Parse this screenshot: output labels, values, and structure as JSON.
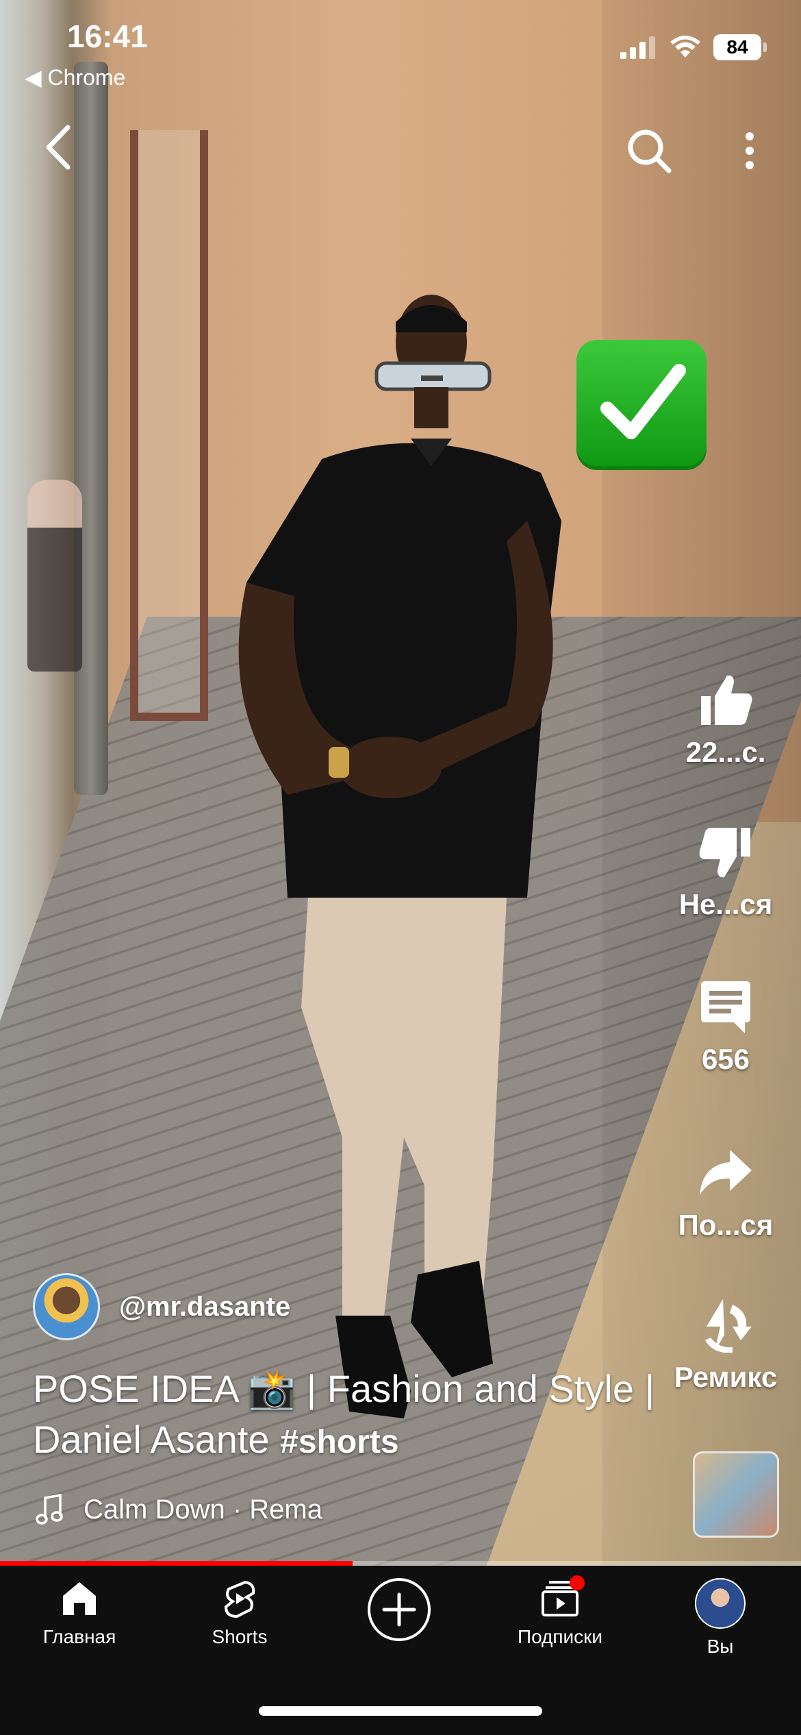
{
  "status_bar": {
    "time": "16:41",
    "back_app": "◀ Chrome",
    "battery": "84"
  },
  "top_bar": {
    "back_icon": "chevron-left-icon",
    "search_icon": "search-icon",
    "more_icon": "more-vertical-icon"
  },
  "overlay_emoji": "✅",
  "actions": {
    "like": {
      "label": "22...с.",
      "icon": "thumbs-up-icon"
    },
    "dislike": {
      "label": "Не...ся",
      "icon": "thumbs-down-icon"
    },
    "comments": {
      "label": "656",
      "icon": "comment-icon"
    },
    "share": {
      "label": "По...ся",
      "icon": "share-icon"
    },
    "remix": {
      "label": "Ремикс",
      "icon": "remix-icon"
    }
  },
  "video": {
    "channel_handle": "@mr.dasante",
    "title": "POSE IDEA 📸 | Fashion and Style | Daniel Asante",
    "hashtag": "#shorts",
    "music": "Calm Down · Rema",
    "progress_fraction": 0.44
  },
  "nav": {
    "home": "Главная",
    "shorts": "Shorts",
    "subscriptions": "Подписки",
    "you": "Вы"
  },
  "colors": {
    "accent": "#ff0000",
    "nav_bg": "#0f0f0f"
  }
}
